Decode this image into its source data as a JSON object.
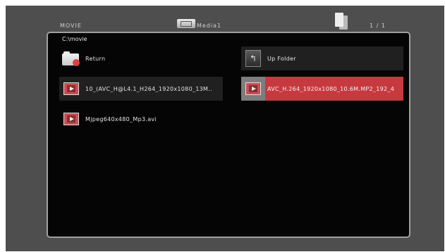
{
  "header": {
    "section": "MOVIE",
    "device": "Media1",
    "page_indicator": "1 / 1",
    "icons": [
      "usb-icon",
      "page-icon"
    ]
  },
  "browser": {
    "path": "C:\\movie",
    "items": [
      {
        "label": "Return",
        "icon": "return-folder-icon",
        "selected": false
      },
      {
        "label": "Up Folder",
        "icon": "up-folder-icon",
        "selected": false
      },
      {
        "label": "10_(AVC_H@L4.1_H264_1920x1080_13M..",
        "icon": "film-icon",
        "selected": false
      },
      {
        "label": "AVC_H.264_1920x1080_10.6M.MP2_192_4",
        "icon": "film-icon",
        "selected": true
      },
      {
        "label": "Mjpeg640x480_Mp3.avi",
        "icon": "film-icon",
        "selected": false
      }
    ]
  },
  "colors": {
    "frame": "#4e4e4e",
    "panel": "#050505",
    "selected": "#c63a3f"
  }
}
